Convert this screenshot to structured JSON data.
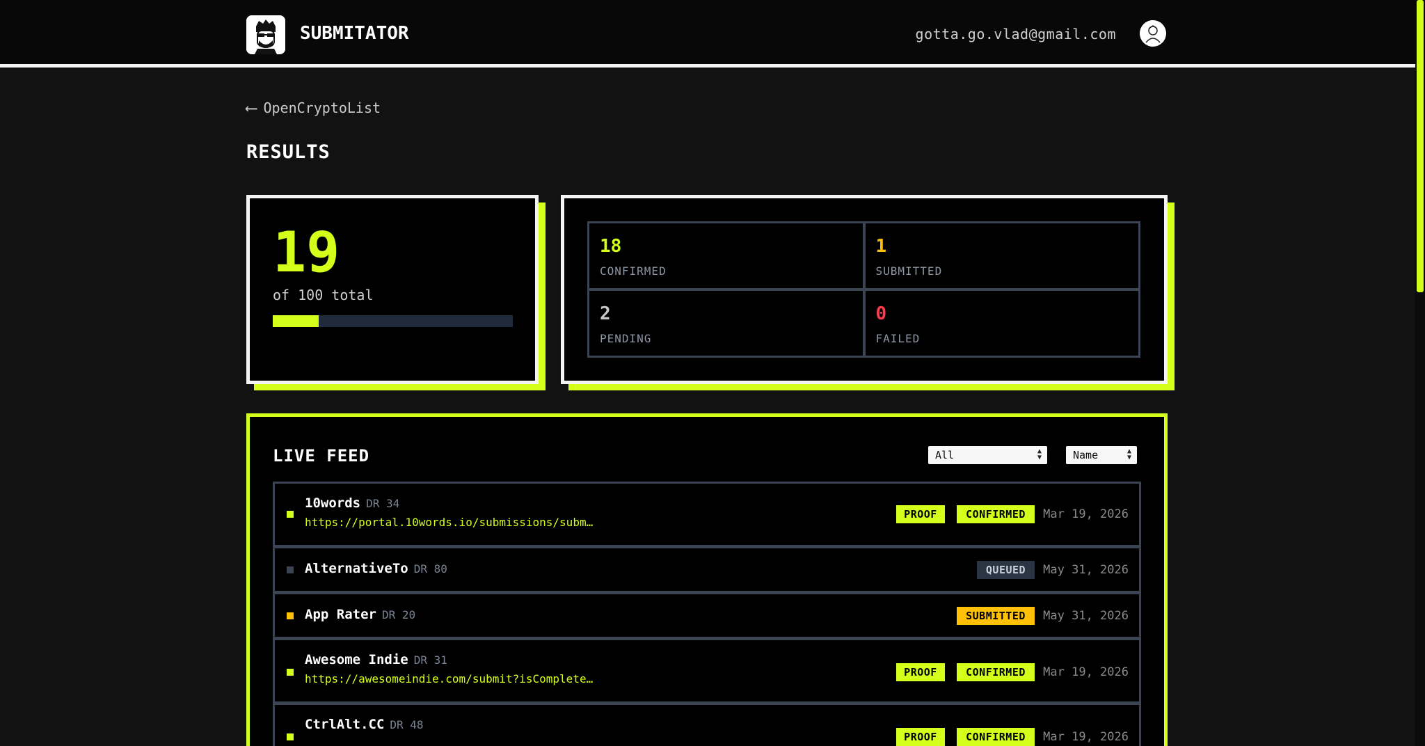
{
  "header": {
    "brand": "SUBMITATOR",
    "user_email": "gotta.go.vlad@gmail.com"
  },
  "nav": {
    "back_label": "OpenCryptoList",
    "back_icon": "arrow-left-icon"
  },
  "results": {
    "title": "RESULTS",
    "done_count": "19",
    "total_text": "of 100 total",
    "progress_percent": 19,
    "stats": {
      "confirmed": {
        "value": "18",
        "label": "CONFIRMED",
        "color": "#d4ff1a"
      },
      "submitted": {
        "value": "1",
        "label": "SUBMITTED",
        "color": "#ffc107"
      },
      "pending": {
        "value": "2",
        "label": "PENDING",
        "color": "#c8c8c8"
      },
      "failed": {
        "value": "0",
        "label": "FAILED",
        "color": "#ff3b4e"
      }
    }
  },
  "feed": {
    "title": "LIVE FEED",
    "filter_selected": "All",
    "sort_selected": "Name",
    "rows": [
      {
        "name": "10words",
        "dr": "DR 34",
        "url": "https://portal.10words.io/submissions/subm…",
        "badges": [
          "PROOF",
          "CONFIRMED"
        ],
        "date": "Mar 19, 2026",
        "dot_color": "#d4ff1a"
      },
      {
        "name": "AlternativeTo",
        "dr": "DR 80",
        "url": "",
        "badges": [
          "QUEUED"
        ],
        "date": "May 31, 2026",
        "dot_color": "#3a4453"
      },
      {
        "name": "App Rater",
        "dr": "DR 20",
        "url": "",
        "badges": [
          "SUBMITTED"
        ],
        "date": "May 31, 2026",
        "dot_color": "#ffc107"
      },
      {
        "name": "Awesome Indie",
        "dr": "DR 31",
        "url": "https://awesomeindie.com/submit?isComplete…",
        "badges": [
          "PROOF",
          "CONFIRMED"
        ],
        "date": "Mar 19, 2026",
        "dot_color": "#d4ff1a"
      },
      {
        "name": "CtrlAlt.CC",
        "dr": "DR 48",
        "url": "",
        "badges": [
          "PROOF",
          "CONFIRMED"
        ],
        "date": "Mar 19, 2026",
        "dot_color": "#d4ff1a"
      }
    ]
  },
  "colors": {
    "accent": "#d4ff1a",
    "warning": "#ffc107",
    "danger": "#ff3b4e",
    "muted": "#3a4453"
  }
}
